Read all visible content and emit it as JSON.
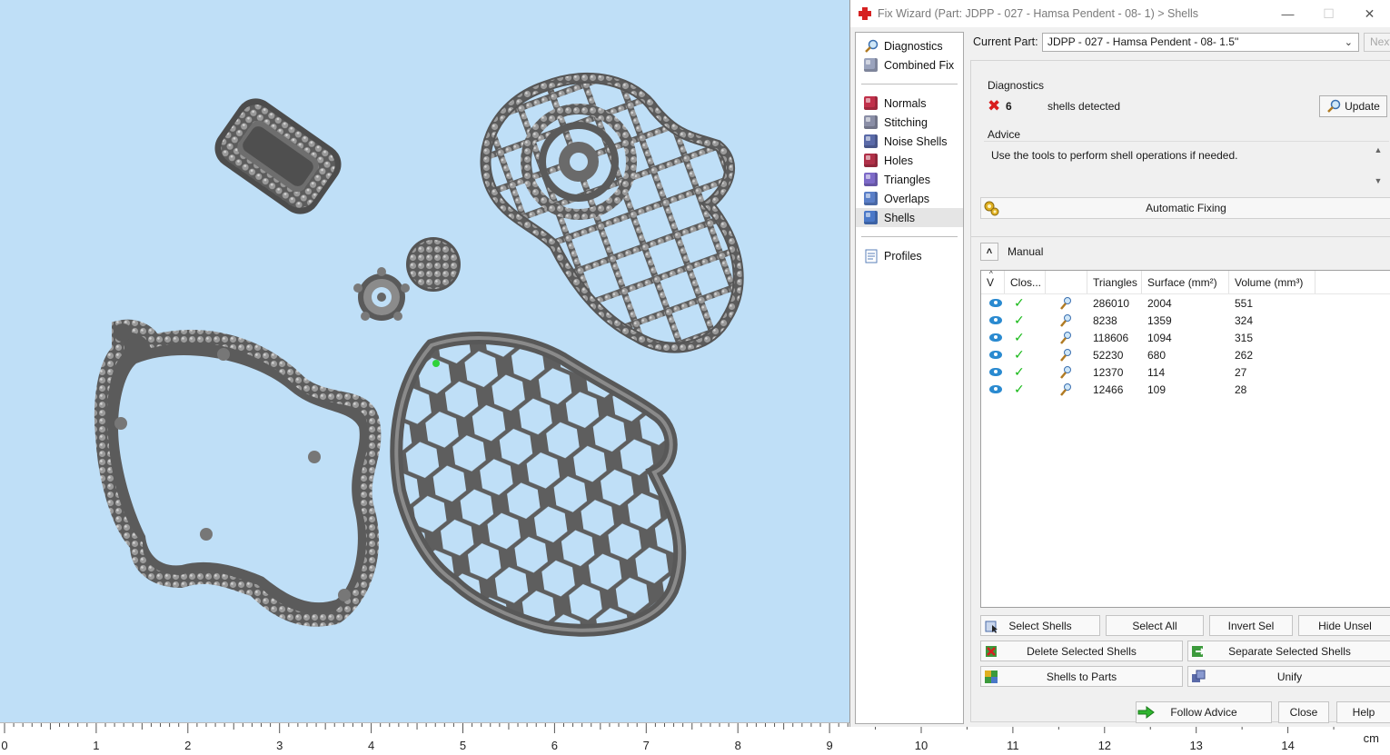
{
  "window": {
    "title": "Fix Wizard (Part: JDPP - 027 - Hamsa Pendent - 08- 1) > Shells",
    "minimize": "—",
    "maximize": "☐",
    "close": "✕"
  },
  "nav": {
    "group1": [
      {
        "label": "Diagnostics",
        "icon": "magnifier-icon"
      },
      {
        "label": "Combined Fix",
        "icon": "combined-fix-icon"
      }
    ],
    "group2": [
      {
        "label": "Normals",
        "icon": "normals-icon",
        "color": "#c0304a"
      },
      {
        "label": "Stitching",
        "icon": "stitching-icon",
        "color": "#8a8ea6"
      },
      {
        "label": "Noise Shells",
        "icon": "noise-shells-icon",
        "color": "#5a6aa8"
      },
      {
        "label": "Holes",
        "icon": "holes-icon",
        "color": "#b03048"
      },
      {
        "label": "Triangles",
        "icon": "triangles-icon",
        "color": "#7d6ac8"
      },
      {
        "label": "Overlaps",
        "icon": "overlaps-icon",
        "color": "#5a7fc8"
      },
      {
        "label": "Shells",
        "icon": "shells-icon",
        "color": "#4a78c8",
        "selected": true
      }
    ],
    "group3": [
      {
        "label": "Profiles",
        "icon": "profiles-icon"
      }
    ]
  },
  "part": {
    "label": "Current Part:",
    "value": "JDPP - 027 - Hamsa Pendent - 08- 1.5''",
    "next": "Next"
  },
  "diagnostics": {
    "title": "Diagnostics",
    "count": "6",
    "text": "shells detected",
    "update": "Update"
  },
  "advice": {
    "title": "Advice",
    "text": "Use the tools to perform shell operations if needed."
  },
  "auto_fixing": "Automatic Fixing",
  "manual": {
    "title": "Manual",
    "headers": [
      "V",
      "Clos...",
      "",
      "Triangles",
      "Surface (mm²)",
      "Volume (mm³)"
    ],
    "rows": [
      {
        "triangles": "286010",
        "surface": "2004",
        "volume": "551"
      },
      {
        "triangles": "8238",
        "surface": "1359",
        "volume": "324"
      },
      {
        "triangles": "118606",
        "surface": "1094",
        "volume": "315"
      },
      {
        "triangles": "52230",
        "surface": "680",
        "volume": "262"
      },
      {
        "triangles": "12370",
        "surface": "114",
        "volume": "27"
      },
      {
        "triangles": "12466",
        "surface": "109",
        "volume": "28"
      }
    ]
  },
  "buttons": {
    "select_shells": "Select Shells",
    "select_all": "Select All",
    "invert_sel": "Invert Sel",
    "hide_unsel": "Hide Unsel",
    "delete_selected": "Delete Selected Shells",
    "separate_selected": "Separate Selected Shells",
    "shells_to_parts": "Shells to Parts",
    "unify": "Unify",
    "follow_advice": "Follow Advice",
    "close": "Close",
    "help": "Help"
  },
  "ruler": {
    "labels": [
      "0",
      "1",
      "2",
      "3",
      "4",
      "5",
      "6",
      "7",
      "8",
      "9",
      "10",
      "11",
      "12",
      "13",
      "14"
    ],
    "unit": "cm"
  }
}
